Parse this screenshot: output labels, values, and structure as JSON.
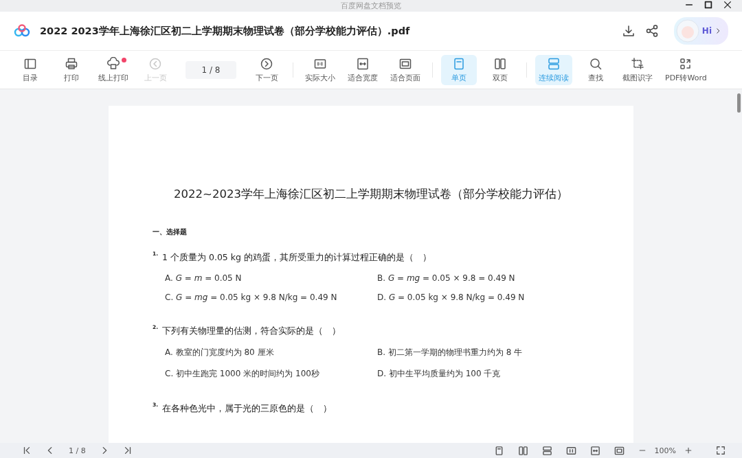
{
  "window": {
    "title": "百度网盘文档预览"
  },
  "header": {
    "file_name": "2022 2023学年上海徐汇区初二上学期期末物理试卷（部分学校能力评估）.pdf",
    "greeting": "Hi"
  },
  "toolbar": [
    {
      "kind": "button",
      "label": "目录",
      "selected": false,
      "disabled": false,
      "badge": false
    },
    {
      "kind": "button",
      "label": "打印",
      "selected": false,
      "disabled": false,
      "badge": false
    },
    {
      "kind": "button",
      "label": "线上打印",
      "selected": false,
      "disabled": false,
      "badge": true
    },
    {
      "kind": "button",
      "label": "上一页",
      "selected": false,
      "disabled": true,
      "badge": false
    },
    {
      "kind": "page",
      "value": "1 / 8"
    },
    {
      "kind": "button",
      "label": "下一页",
      "selected": false,
      "disabled": false,
      "badge": false
    },
    {
      "kind": "divider"
    },
    {
      "kind": "button",
      "label": "实际大小",
      "selected": false,
      "disabled": false,
      "badge": false
    },
    {
      "kind": "button",
      "label": "适合宽度",
      "selected": false,
      "disabled": false,
      "badge": false
    },
    {
      "kind": "button",
      "label": "适合页面",
      "selected": false,
      "disabled": false,
      "badge": false
    },
    {
      "kind": "divider"
    },
    {
      "kind": "button",
      "label": "单页",
      "selected": true,
      "disabled": false,
      "badge": false
    },
    {
      "kind": "button",
      "label": "双页",
      "selected": false,
      "disabled": false,
      "badge": false
    },
    {
      "kind": "divider"
    },
    {
      "kind": "button",
      "label": "连续阅读",
      "selected": true,
      "disabled": false,
      "badge": false
    },
    {
      "kind": "button",
      "label": "查找",
      "selected": false,
      "disabled": false,
      "badge": false
    },
    {
      "kind": "button",
      "label": "截图识字",
      "selected": false,
      "disabled": false,
      "badge": false
    },
    {
      "kind": "button",
      "label": "PDF转Word",
      "selected": false,
      "disabled": false,
      "badge": false
    }
  ],
  "document": {
    "title": "2022~2023学年上海徐汇区初二上学期期末物理试卷（部分学校能力评估）",
    "section": "一、选择题",
    "questions": [
      {
        "number": "1.",
        "text": "1 个质量为 0.05 kg 的鸡蛋，其所受重力的计算过程正确的是（　）",
        "options": [
          "A.  *G* = *m* = 0.05 N",
          "B. *G* = *mg* = 0.05 × 9.8 = 0.49 N",
          "C. *G* = *mg* = 0.05 kg × 9.8 N/kg = 0.49 N",
          "D. *G* = 0.05 kg × 9.8 N/kg = 0.49 N"
        ]
      },
      {
        "number": "2.",
        "text": "下列有关物理量的估测，符合实际的是（　）",
        "options": [
          "A. 教室的门宽度约为 80 厘米",
          "B. 初二第一学期的物理书重力约为 8 牛",
          "C. 初中生跑完 1000 米的时间约为 100秒",
          "D. 初中生平均质量约为 100 千克"
        ]
      },
      {
        "number": "3.",
        "text": "在各种色光中，属于光的三原色的是（　）"
      }
    ]
  },
  "status_bar": {
    "page": "1 / 8",
    "zoom": "100%"
  }
}
